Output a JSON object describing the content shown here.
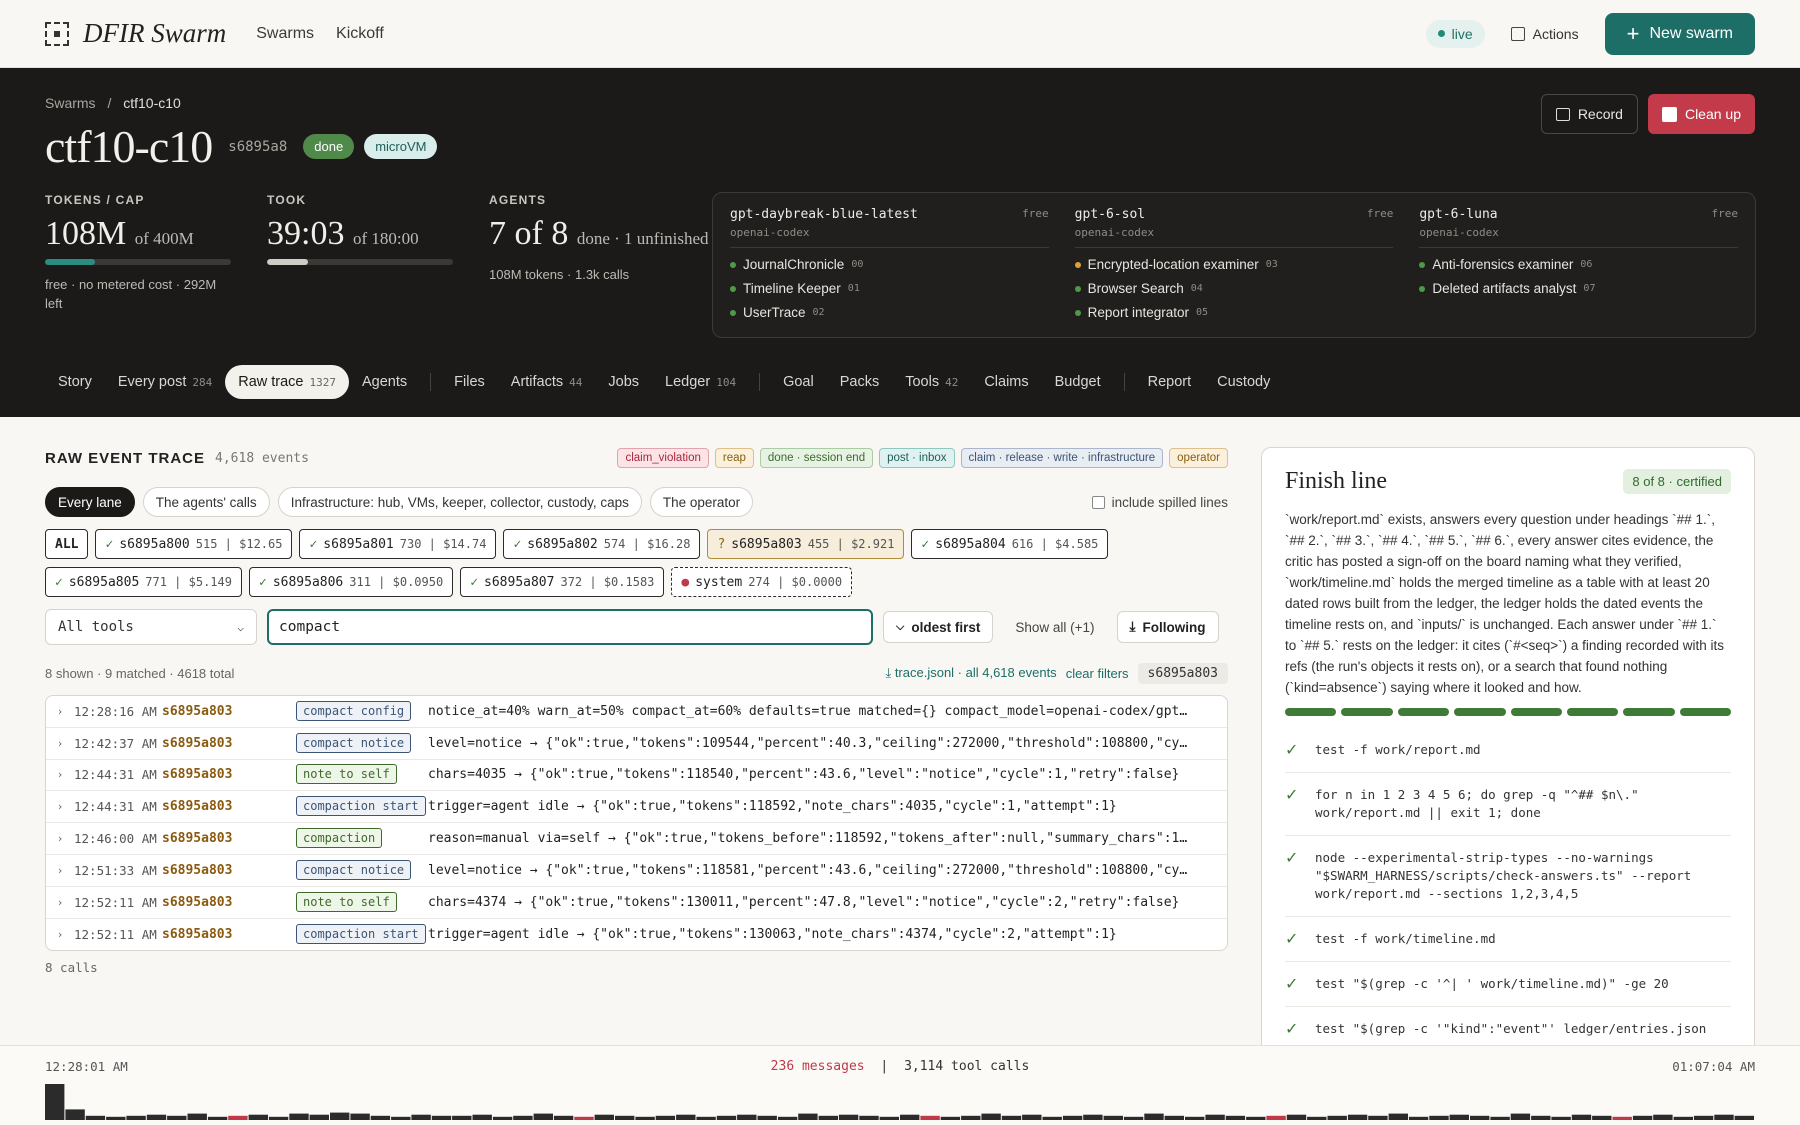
{
  "topnav": {
    "brand": "DFIR Swarm",
    "links": [
      "Swarms",
      "Kickoff"
    ],
    "live_label": "live",
    "actions_label": "Actions",
    "new_swarm_label": "New swarm"
  },
  "hero": {
    "breadcrumb": {
      "root": "Swarms",
      "sep": "/",
      "current": "ctf10-c10"
    },
    "title": "ctf10-c10",
    "hash": "s6895a8",
    "status_badge": "done",
    "vm_badge": "microVM",
    "record_label": "Record",
    "cleanup_label": "Clean up",
    "stats": {
      "tokens": {
        "label": "TOKENS / CAP",
        "value": "108M",
        "of": "of 400M",
        "progress": 0.27,
        "sub": "free · no metered cost · 292M left"
      },
      "took": {
        "label": "TOOK",
        "value": "39:03",
        "of": "of 180:00",
        "progress": 0.22
      },
      "agents": {
        "label": "AGENTS",
        "value": "7 of 8",
        "of": "done · 1 unfinished",
        "sub": "108M tokens · 1.3k calls"
      }
    },
    "models": [
      {
        "name": "gpt-daybreak-blue-latest",
        "provider": "openai-codex",
        "tier": "free",
        "agents": [
          {
            "name": "JournalChronicle",
            "num": "00",
            "status": "done"
          },
          {
            "name": "Timeline Keeper",
            "num": "01",
            "status": "done"
          },
          {
            "name": "UserTrace",
            "num": "02",
            "status": "done"
          }
        ]
      },
      {
        "name": "gpt-6-sol",
        "provider": "openai-codex",
        "tier": "free",
        "agents": [
          {
            "name": "Encrypted-location examiner",
            "num": "03",
            "status": "unfinished"
          },
          {
            "name": "Browser Search",
            "num": "04",
            "status": "done"
          },
          {
            "name": "Report integrator",
            "num": "05",
            "status": "done"
          }
        ]
      },
      {
        "name": "gpt-6-luna",
        "provider": "openai-codex",
        "tier": "free",
        "agents": [
          {
            "name": "Anti-forensics examiner",
            "num": "06",
            "status": "done"
          },
          {
            "name": "Deleted artifacts analyst",
            "num": "07",
            "status": "done"
          }
        ]
      }
    ],
    "tabs": [
      {
        "label": "Story",
        "count": ""
      },
      {
        "label": "Every post",
        "count": "284"
      },
      {
        "label": "Raw trace",
        "count": "1327",
        "active": true
      },
      {
        "label": "Agents",
        "count": ""
      },
      {
        "sep": true
      },
      {
        "label": "Files",
        "count": ""
      },
      {
        "label": "Artifacts",
        "count": "44"
      },
      {
        "label": "Jobs",
        "count": ""
      },
      {
        "label": "Ledger",
        "count": "104"
      },
      {
        "sep": true
      },
      {
        "label": "Goal",
        "count": ""
      },
      {
        "label": "Packs",
        "count": ""
      },
      {
        "label": "Tools",
        "count": "42"
      },
      {
        "label": "Claims",
        "count": ""
      },
      {
        "label": "Budget",
        "count": ""
      },
      {
        "sep": true
      },
      {
        "label": "Report",
        "count": ""
      },
      {
        "label": "Custody",
        "count": ""
      }
    ]
  },
  "trace": {
    "title": "RAW EVENT TRACE",
    "count": "4,618 events",
    "legend": [
      {
        "label": "claim_violation",
        "bg": "#fbe3e6",
        "border": "#e3a3ad",
        "fg": "#a8283b"
      },
      {
        "label": "reap",
        "bg": "#fbf0dc",
        "border": "#e0c08a",
        "fg": "#8a5e10"
      },
      {
        "label": "done · session end",
        "bg": "#e6f2e3",
        "border": "#a9cca0",
        "fg": "#3e6b2c"
      },
      {
        "label": "post · inbox",
        "bg": "#dff1f0",
        "border": "#8ec8c2",
        "fg": "#1f5e58"
      },
      {
        "label": "claim · release · write · infrastructure",
        "bg": "#e8ecf3",
        "border": "#a9b6cc",
        "fg": "#3c5575"
      },
      {
        "label": "operator",
        "bg": "#fbf0dc",
        "border": "#e0c08a",
        "fg": "#8a5e10"
      }
    ],
    "lane_filters": [
      "Every lane",
      "The agents' calls",
      "Infrastructure: hub, VMs, keeper, collector, custody, caps",
      "The operator"
    ],
    "spilled_label": "include spilled lines",
    "lanes": [
      {
        "mark": "",
        "id": "ALL",
        "meta": "",
        "kind": "all"
      },
      {
        "mark": "✓",
        "id": "s6895a800",
        "meta": "515 | $12.65",
        "kind": "ok"
      },
      {
        "mark": "✓",
        "id": "s6895a801",
        "meta": "730 | $14.74",
        "kind": "ok"
      },
      {
        "mark": "✓",
        "id": "s6895a802",
        "meta": "574 | $16.28",
        "kind": "ok"
      },
      {
        "mark": "?",
        "id": "s6895a803",
        "meta": "455 | $2.921",
        "kind": "warn"
      },
      {
        "mark": "✓",
        "id": "s6895a804",
        "meta": "616 | $4.585",
        "kind": "ok"
      },
      {
        "mark": "✓",
        "id": "s6895a805",
        "meta": "771 | $5.149",
        "kind": "ok"
      },
      {
        "mark": "✓",
        "id": "s6895a806",
        "meta": "311 | $0.0950",
        "kind": "ok"
      },
      {
        "mark": "✓",
        "id": "s6895a807",
        "meta": "372 | $0.1583",
        "kind": "ok"
      },
      {
        "mark": "●",
        "id": "system",
        "meta": "274 | $0.0000",
        "kind": "sys"
      }
    ],
    "tool_select": "All tools",
    "search_value": "compact",
    "order_label": "oldest first",
    "show_all_label": "Show all (+1)",
    "following_label": "Following",
    "summary": "8 shown · 9 matched · 4618 total",
    "download_label": "trace.jsonl · all 4,618 events",
    "clear_label": "clear filters",
    "lane_chip": "s6895a803",
    "events": [
      {
        "time": "12:28:16 AM",
        "lane": "s6895a803",
        "kind": "compact config",
        "style": "cfg",
        "detail": "notice_at=40% warn_at=50% compact_at=60% defaults=true matched={} compact_model=openai-codex/gpt…"
      },
      {
        "time": "12:42:37 AM",
        "lane": "s6895a803",
        "kind": "compact notice",
        "style": "cfg",
        "detail": "level=notice → {\"ok\":true,\"tokens\":109544,\"percent\":40.3,\"ceiling\":272000,\"threshold\":108800,\"cy…"
      },
      {
        "time": "12:44:31 AM",
        "lane": "s6895a803",
        "kind": "note to self",
        "style": "note",
        "detail": "chars=4035 → {\"ok\":true,\"tokens\":118540,\"percent\":43.6,\"level\":\"notice\",\"cycle\":1,\"retry\":false}"
      },
      {
        "time": "12:44:31 AM",
        "lane": "s6895a803",
        "kind": "compaction start",
        "style": "cfg",
        "detail": "trigger=agent idle → {\"ok\":true,\"tokens\":118592,\"note_chars\":4035,\"cycle\":1,\"attempt\":1}"
      },
      {
        "time": "12:46:00 AM",
        "lane": "s6895a803",
        "kind": "compaction",
        "style": "note",
        "detail": "reason=manual via=self → {\"ok\":true,\"tokens_before\":118592,\"tokens_after\":null,\"summary_chars\":1…"
      },
      {
        "time": "12:51:33 AM",
        "lane": "s6895a803",
        "kind": "compact notice",
        "style": "cfg",
        "detail": "level=notice → {\"ok\":true,\"tokens\":118581,\"percent\":43.6,\"ceiling\":272000,\"threshold\":108800,\"cy…"
      },
      {
        "time": "12:52:11 AM",
        "lane": "s6895a803",
        "kind": "note to self",
        "style": "note",
        "detail": "chars=4374 → {\"ok\":true,\"tokens\":130011,\"percent\":47.8,\"level\":\"notice\",\"cycle\":2,\"retry\":false}"
      },
      {
        "time": "12:52:11 AM",
        "lane": "s6895a803",
        "kind": "compaction start",
        "style": "cfg",
        "detail": "trigger=agent idle → {\"ok\":true,\"tokens\":130063,\"note_chars\":4374,\"cycle\":2,\"attempt\":1}"
      }
    ],
    "calls_label": "8 calls"
  },
  "finish": {
    "title": "Finish line",
    "badge": "8 of 8 · certified",
    "text": "`work/report.md` exists, answers every question under headings `## 1.`, `## 2.`, `## 3.`, `## 4.`, `## 5.`, `## 6.`, every answer cites evidence, the critic has posted a sign-off on the board naming what they verified, `work/timeline.md` holds the merged timeline as a table with at least 20 dated rows built from the ledger, the ledger holds the dated events the timeline rests on, and `inputs/` is unchanged. Each answer under `## 1.` to `## 5.` rests on the ledger: it cites (`#<seq>`) a finding recorded with its refs (the run's objects it rests on), or a search that found nothing (`kind=absence`) saying where it looked and how.",
    "segments": 8,
    "checks": [
      "test -f work/report.md",
      "for n in 1 2 3 4 5 6; do grep -q \"^## $n\\.\" work/report.md || exit 1; done",
      "node --experimental-strip-types --no-warnings \"$SWARM_HARNESS/scripts/check-answers.ts\" --report work/report.md --sections 1,2,3,4,5",
      "test -f work/timeline.md",
      "test \"$(grep -c '^| ' work/timeline.md)\" -ge 20",
      "test \"$(grep -c '\"kind\":\"event\"' ledger/entries.json"
    ]
  },
  "timeline": {
    "start": "12:28:01 AM",
    "messages": "236 messages",
    "sep": "|",
    "tool_calls": "3,114 tool calls",
    "end": "01:07:04 AM",
    "activity": [
      34,
      10,
      4,
      3,
      4,
      5,
      4,
      6,
      3,
      4,
      5,
      3,
      6,
      5,
      7,
      6,
      4,
      3,
      5,
      4,
      4,
      5,
      3,
      4,
      6,
      4,
      3,
      5,
      4,
      3,
      4,
      5,
      3,
      4,
      5,
      4,
      3,
      6,
      4,
      5,
      4,
      3,
      5,
      4,
      3,
      4,
      6,
      4,
      5,
      3,
      4,
      5,
      4,
      3,
      6,
      4,
      3,
      5,
      4,
      3,
      4,
      5,
      3,
      4,
      5,
      4,
      6,
      3,
      4,
      5,
      4,
      3,
      6,
      4,
      3,
      5,
      4,
      3,
      4,
      5,
      3,
      4,
      5,
      4
    ]
  }
}
